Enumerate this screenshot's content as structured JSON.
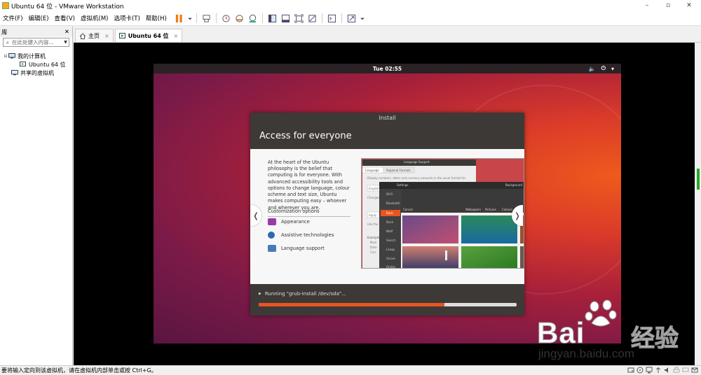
{
  "window": {
    "title": "Ubuntu 64 位 - VMware Workstation",
    "minimize": "–",
    "maximize": "▫",
    "close": "✕"
  },
  "menu": [
    "文件(F)",
    "编辑(E)",
    "查看(V)",
    "虚拟机(M)",
    "选项卡(T)",
    "帮助(H)"
  ],
  "library": {
    "title": "库",
    "close": "✕",
    "search_placeholder": "在此处键入内容...",
    "tree": {
      "my_computer": "我的计算机",
      "vm": "Ubuntu 64 位",
      "shared": "共享的虚拟机"
    }
  },
  "tabs": [
    {
      "label": "主页",
      "close": "×"
    },
    {
      "label": "Ubuntu 64 位",
      "close": "×"
    }
  ],
  "guest": {
    "clock": "Tue 02:55",
    "dialog_title": "Install",
    "header": "Access for everyone",
    "intro": "At the heart of the Ubuntu philosophy is the belief that computing is for everyone. With advanced accessibility tools and options to change language, colour scheme and text size, Ubuntu makes computing easy – whoever and wherever you are.",
    "custom_heading": "Customization options",
    "options": [
      "Appearance",
      "Assistive technologies",
      "Language support"
    ],
    "prev": "❬",
    "next": "❭",
    "status": "Running \"grub-install /dev/sda\"...",
    "progress": 0.72,
    "shot": {
      "lang_title": "Language Support",
      "lang_tabs": [
        "Language",
        "Regional Formats"
      ],
      "lang_text": "Display numbers, dates and currency amounts in the usual format for:",
      "lang_rows": [
        "English",
        "Changes",
        "Apply",
        "Use the",
        "Example",
        "Num",
        "Date",
        "Curr"
      ],
      "settings_title": "Settings",
      "background_title": "Background",
      "settings_items": [
        "Wi-Fi",
        "Bluetooth",
        "Back",
        "Dock",
        "Notif",
        "Search",
        "Langu",
        "Univer",
        "Online"
      ],
      "picker_cancel": "Cancel",
      "picker_tabs": [
        "Wallpapers",
        "Pictures",
        "Colours"
      ]
    }
  },
  "statusbar": {
    "text": "要将输入定向到该虚拟机，请在虚拟机内部单击或按 Ctrl+G。"
  },
  "watermark": {
    "brand": "Bai",
    "brand2": "经验",
    "url": "jingyan.baidu.com"
  },
  "colors": {
    "ubuntu_orange": "#e95420",
    "aubergine": "#5a1540",
    "dialog_dark": "#3d3937"
  }
}
